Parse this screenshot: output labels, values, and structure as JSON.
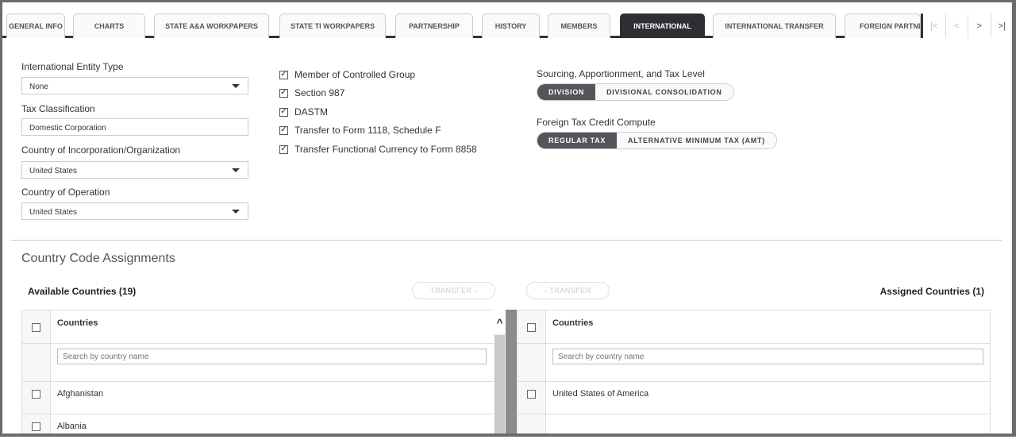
{
  "tabs": [
    "GENERAL INFO",
    "CHARTS",
    "STATE A&A WORKPAPERS",
    "STATE TI WORKPAPERS",
    "PARTNERSHIP",
    "HISTORY",
    "MEMBERS",
    "INTERNATIONAL",
    "INTERNATIONAL TRANSFER",
    "FOREIGN PARTNE"
  ],
  "active_tab": "INTERNATIONAL",
  "tab_nav": {
    "first": "|<",
    "prev": "<",
    "next": ">",
    "last": ">|"
  },
  "form": {
    "entity_type_label": "International Entity Type",
    "entity_type_value": "None",
    "tax_class_label": "Tax Classification",
    "tax_class_value": "Domestic Corporation",
    "country_inc_label": "Country of Incorporation/Organization",
    "country_inc_value": "United States",
    "country_op_label": "Country of Operation",
    "country_op_value": "United States"
  },
  "checkboxes": [
    {
      "label": "Member of Controlled Group",
      "checked": true
    },
    {
      "label": "Section 987",
      "checked": true
    },
    {
      "label": "DASTM",
      "checked": true
    },
    {
      "label": "Transfer to Form 1118, Schedule F",
      "checked": true
    },
    {
      "label": "Transfer Functional Currency to Form 8858",
      "checked": true
    }
  ],
  "sourcing": {
    "label": "Sourcing, Apportionment, and Tax Level",
    "options": [
      "DIVISION",
      "DIVISIONAL CONSOLIDATION"
    ],
    "selected": "DIVISION"
  },
  "ftc": {
    "label": "Foreign Tax Credit Compute",
    "options": [
      "REGULAR TAX",
      "ALTERNATIVE MINIMUM TAX (AMT)"
    ],
    "selected": "REGULAR TAX"
  },
  "assign": {
    "title": "Country Code Assignments",
    "available_label": "Available Countries (19)",
    "assigned_label": "Assigned Countries (1)",
    "transfer_right": "TRANSFER ›",
    "transfer_left": "‹ TRANSFER",
    "col_header": "Countries",
    "search_placeholder": "Search by country name",
    "available": [
      "Afghanistan",
      "Albania"
    ],
    "assigned": [
      "United States of America"
    ]
  },
  "colors": {
    "active_tab": "#2f2f33",
    "segment_on": "#54555c"
  }
}
